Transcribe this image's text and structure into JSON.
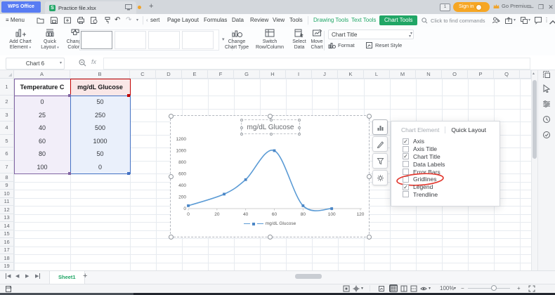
{
  "titlebar": {
    "app_name": "WPS Office",
    "doc_tab": "Practice file.xlsx",
    "badge": "1",
    "sign_in": "Sign in",
    "go_premium": "Go Premium"
  },
  "menubar": {
    "menu": "Menu",
    "insert_partial": "sert",
    "tabs": [
      "Page Layout",
      "Formulas",
      "Data",
      "Review",
      "View",
      "Tools"
    ],
    "context_tabs": [
      "Drawing Tools",
      "Text Tools"
    ],
    "active_context_tab": "Chart Tools",
    "search_placeholder": "Click to find commands"
  },
  "ribbon": {
    "add_chart_element": "Add Chart Element",
    "quick_layout": "Quick Layout",
    "change_color": "Change Color",
    "change_chart_type": "Change Chart Type",
    "switch_row_column": "Switch Row/Column",
    "select_data": "Select Data",
    "move_chart": "Move Chart",
    "chart_title_combo": "Chart Title",
    "format": "Format",
    "reset_style": "Reset Style"
  },
  "formulabar": {
    "name_box": "Chart 6",
    "fx": "fx"
  },
  "grid": {
    "columns": [
      "A",
      "B",
      "C",
      "D",
      "E",
      "F",
      "G",
      "H",
      "I",
      "J",
      "K",
      "L",
      "M",
      "N",
      "O",
      "P",
      "Q"
    ],
    "row_numbers": [
      "1",
      "2",
      "3",
      "4",
      "5",
      "6",
      "7",
      "8",
      "9",
      "10",
      "11",
      "12",
      "13",
      "14",
      "15",
      "16",
      "17",
      "18",
      "19"
    ],
    "table": {
      "headers": [
        "Temperature C",
        "mg/dL Glucose"
      ],
      "rows": [
        [
          0,
          50
        ],
        [
          25,
          250
        ],
        [
          40,
          500
        ],
        [
          60,
          1000
        ],
        [
          80,
          50
        ],
        [
          100,
          0
        ]
      ]
    }
  },
  "chart_data": {
    "type": "line",
    "title": "mg/dL Glucose",
    "series": [
      {
        "name": "mg/dL Glucose",
        "x": [
          0,
          25,
          40,
          60,
          80,
          100
        ],
        "y": [
          50,
          250,
          500,
          1000,
          50,
          0
        ]
      }
    ],
    "x_ticks": [
      0,
      20,
      40,
      60,
      80,
      100,
      120
    ],
    "y_ticks": [
      0,
      200,
      400,
      600,
      800,
      1000,
      1200
    ],
    "xlim": [
      0,
      120
    ],
    "ylim": [
      0,
      1200
    ],
    "legend": "mg/dL Glucose",
    "legend_position": "bottom",
    "gridlines": false,
    "line_color": "#5b9bd5"
  },
  "side_panel": {
    "tabs": [
      "Chart Element",
      "Quick Layout"
    ],
    "items": [
      {
        "label": "Axis",
        "checked": true,
        "highlighted": false
      },
      {
        "label": "Axis Title",
        "checked": false,
        "highlighted": false
      },
      {
        "label": "Chart Title",
        "checked": true,
        "highlighted": false
      },
      {
        "label": "Data Labels",
        "checked": false,
        "highlighted": false
      },
      {
        "label": "Error Bars",
        "checked": false,
        "highlighted": false
      },
      {
        "label": "Gridlines",
        "checked": false,
        "highlighted": true
      },
      {
        "label": "Legend",
        "checked": true,
        "highlighted": false
      },
      {
        "label": "Trendline",
        "checked": false,
        "highlighted": false
      }
    ]
  },
  "sheetbar": {
    "active_sheet": "Sheet1"
  },
  "statusbar": {
    "zoom_level": "100%"
  },
  "colors": {
    "brand_green": "#21a666",
    "wps_blue": "#587cf3",
    "sign_in_orange": "#f6a623",
    "chart_line": "#5b9bd5",
    "range_a_border": "#8064a2",
    "range_b_border": "#4472c4",
    "header_b_border": "#c00000",
    "annotation_red": "#e23b32"
  }
}
